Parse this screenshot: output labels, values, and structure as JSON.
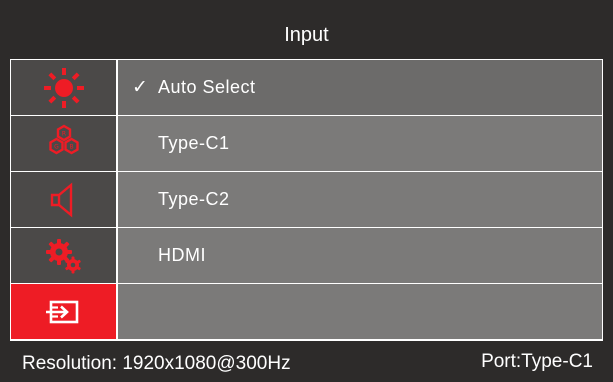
{
  "header": {
    "title": "Input"
  },
  "sidebar": {
    "items": [
      {
        "icon": "brightness-icon",
        "active": false
      },
      {
        "icon": "color-icon",
        "active": false
      },
      {
        "icon": "audio-icon",
        "active": false
      },
      {
        "icon": "settings-icon",
        "active": false
      },
      {
        "icon": "input-source-icon",
        "active": true
      }
    ]
  },
  "options": {
    "check_mark": "✓",
    "items": [
      {
        "label": "Auto Select",
        "selected": true
      },
      {
        "label": "Type-C1",
        "selected": false
      },
      {
        "label": "Type-C2",
        "selected": false
      },
      {
        "label": "HDMI",
        "selected": false
      },
      {
        "label": "",
        "selected": false
      }
    ]
  },
  "status": {
    "resolution": "Resolution: 1920x1080@300Hz",
    "port": "Port:Type-C1"
  },
  "colors": {
    "background": "#2d2b2a",
    "sidebar_item": "#4b4948",
    "sidebar_active": "#ee1c25",
    "option_row": "#7b7a79",
    "icon_red": "#ee1c25",
    "frame_border": "#ffffff"
  }
}
